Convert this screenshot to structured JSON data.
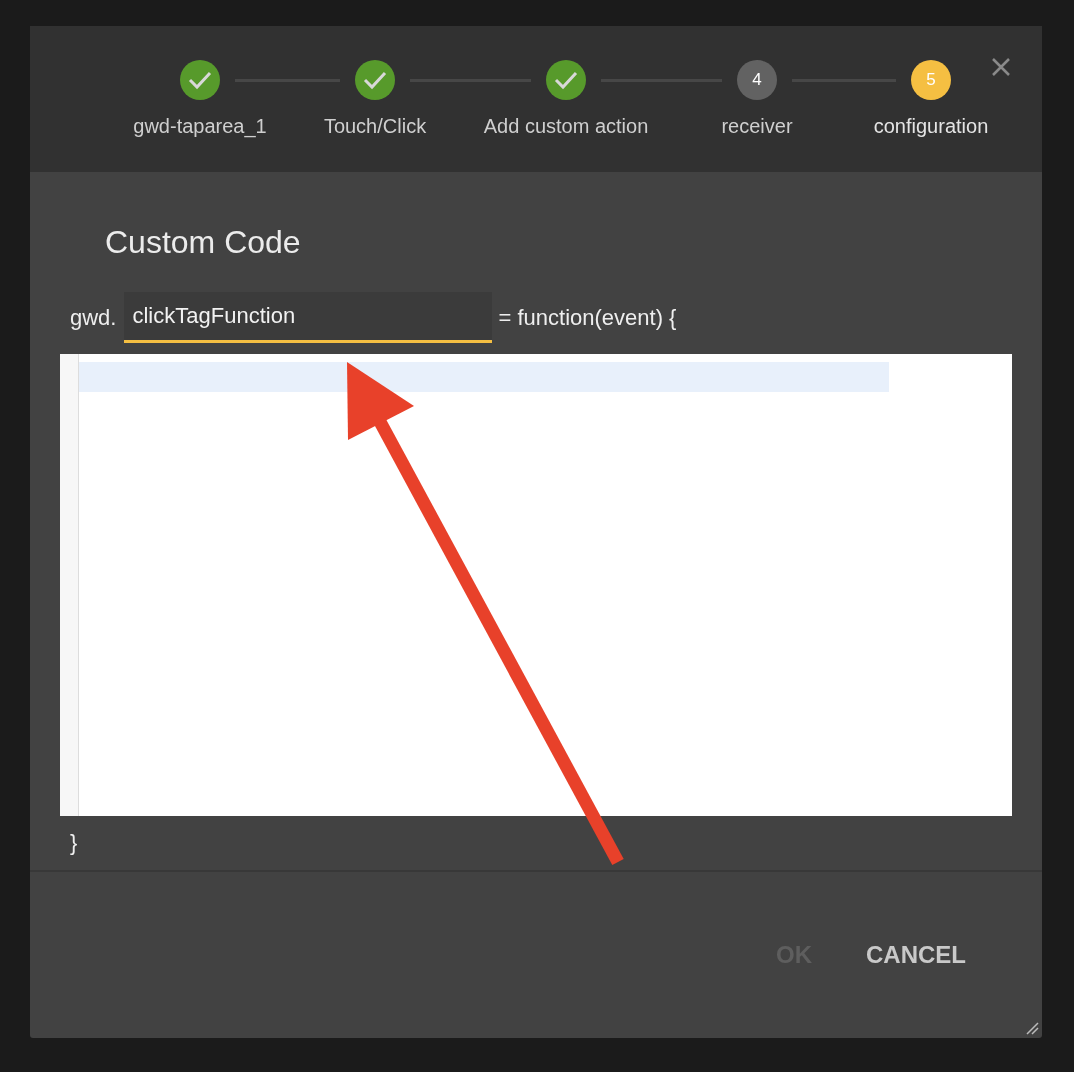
{
  "steps": [
    {
      "label": "gwd-taparea_1",
      "completed": true,
      "selected": false
    },
    {
      "label": "Touch/Click",
      "completed": true,
      "selected": false
    },
    {
      "label": "Add custom action",
      "completed": true,
      "selected": false
    },
    {
      "label": "receiver",
      "completed": false,
      "selected": false,
      "number": "4"
    },
    {
      "label": "configuration",
      "completed": false,
      "selected": true,
      "number": "5"
    }
  ],
  "title": "Custom Code",
  "prefix": "gwd.",
  "function_name": {
    "value": "clickTagFunction",
    "focused": true
  },
  "suffix": "= function(event) {",
  "closing": "}",
  "buttons": [
    {
      "label": "OK",
      "disabled": true
    },
    {
      "label": "CANCEL",
      "disabled": false
    }
  ]
}
